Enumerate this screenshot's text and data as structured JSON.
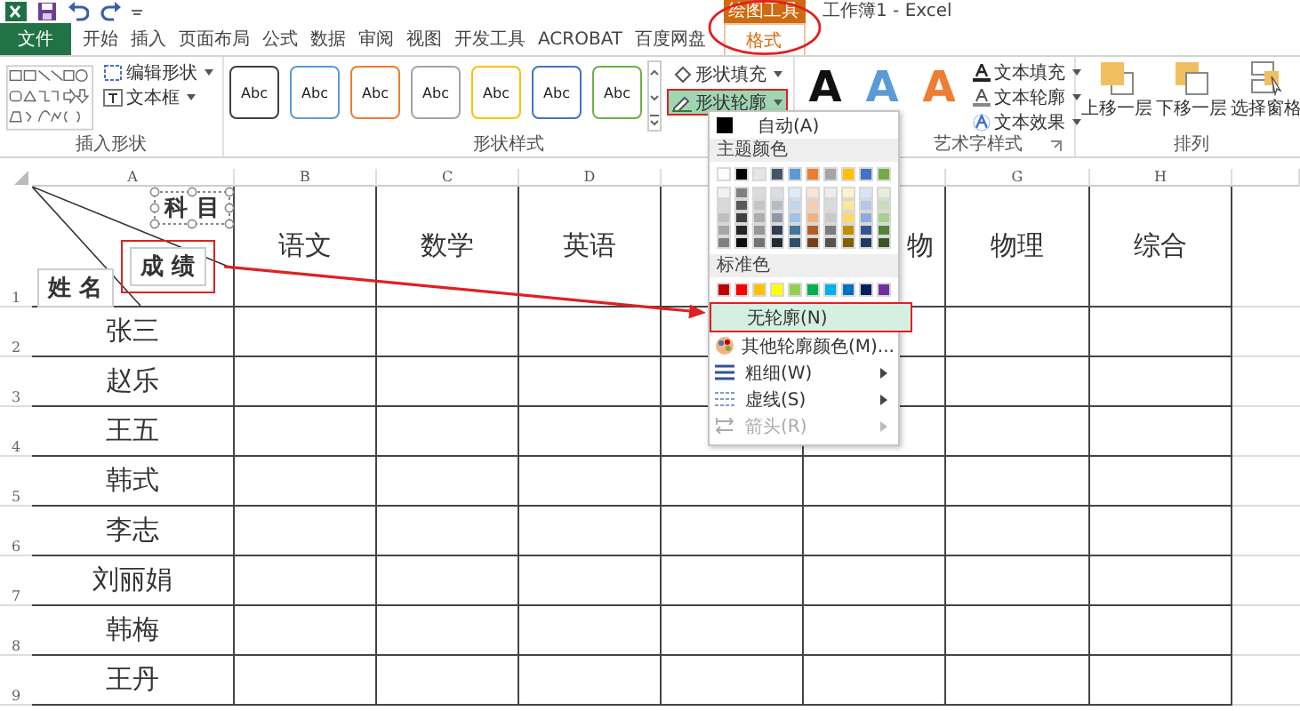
{
  "title_bar": {
    "title": "工作簿1 - Excel",
    "context_label": "绘图工具"
  },
  "tabs": [
    {
      "label": "文件",
      "kind": "file",
      "selected": false
    },
    {
      "label": "开始",
      "kind": "normal",
      "selected": false
    },
    {
      "label": "插入",
      "kind": "normal",
      "selected": false
    },
    {
      "label": "页面布局",
      "kind": "normal",
      "selected": false
    },
    {
      "label": "公式",
      "kind": "normal",
      "selected": false
    },
    {
      "label": "数据",
      "kind": "normal",
      "selected": false
    },
    {
      "label": "审阅",
      "kind": "normal",
      "selected": false
    },
    {
      "label": "视图",
      "kind": "normal",
      "selected": false
    },
    {
      "label": "开发工具",
      "kind": "normal",
      "selected": false
    },
    {
      "label": "ACROBAT",
      "kind": "normal",
      "selected": false
    },
    {
      "label": "百度网盘",
      "kind": "normal",
      "selected": false
    },
    {
      "label": "格式",
      "kind": "contextual",
      "selected": true
    }
  ],
  "ribbon": {
    "insert_shapes": {
      "label": "插入形状",
      "buttons": [
        {
          "label": "编辑形状",
          "kind": "edit"
        },
        {
          "label": "文本框",
          "kind": "textbox"
        }
      ]
    },
    "shape_styles": {
      "label": "形状样式",
      "presets": [
        {
          "text": "Abc",
          "color": "#404040"
        },
        {
          "text": "Abc",
          "color": "#5b9bd5"
        },
        {
          "text": "Abc",
          "color": "#ed7d31"
        },
        {
          "text": "Abc",
          "color": "#a5a5a5"
        },
        {
          "text": "Abc",
          "color": "#ffc000"
        },
        {
          "text": "Abc",
          "color": "#4472c4"
        },
        {
          "text": "Abc",
          "color": "#70ad47"
        }
      ],
      "buttons": [
        {
          "label": "形状填充",
          "kind": "fill",
          "selected": false
        },
        {
          "label": "形状轮廓",
          "kind": "outline",
          "selected": true
        }
      ]
    },
    "wordart": {
      "label": "艺术字样式",
      "letters": [
        {
          "text": "A",
          "kind": "solid",
          "color": "#111111"
        },
        {
          "text": "A",
          "kind": "solid",
          "color": "#5b9bd5"
        },
        {
          "text": "A",
          "kind": "outline",
          "color": "#ed7d31"
        }
      ],
      "buttons": [
        {
          "label": "文本填充",
          "kind": "fill"
        },
        {
          "label": "文本轮廓",
          "kind": "outline"
        },
        {
          "label": "文本效果",
          "kind": "effect"
        }
      ]
    },
    "arrange": {
      "label": "排列",
      "buttons": [
        {
          "label": "上移一层",
          "kind": "forward"
        },
        {
          "label": "下移一层",
          "kind": "backward"
        },
        {
          "label": "选择窗格",
          "kind": "pane"
        }
      ]
    }
  },
  "sheet": {
    "columns_left": [
      "A",
      "B",
      "C",
      "D"
    ],
    "columns_right": [
      "G",
      "H"
    ],
    "subjects_left": [
      "语文",
      "数学",
      "英语"
    ],
    "subject_partial": "物",
    "subjects_right": [
      "物理",
      "综合"
    ],
    "row_numbers": [
      "1",
      "2",
      "3",
      "4",
      "5",
      "6",
      "7",
      "8",
      "9"
    ],
    "names": [
      "张三",
      "赵乐",
      "王五",
      "韩式",
      "李志",
      "刘丽娟",
      "韩梅",
      "王丹"
    ],
    "textboxes": [
      {
        "text": "科 目",
        "kind": "subject",
        "selected": true
      },
      {
        "text": "成 绩",
        "kind": "score",
        "selected": false
      },
      {
        "text": "姓 名",
        "kind": "name",
        "selected": false
      }
    ]
  },
  "menu": {
    "auto_label": "自动(A)",
    "theme_label": "主题颜色",
    "theme_colors": [
      {
        "color": "#ffffff"
      },
      {
        "color": "#000000"
      },
      {
        "color": "#e7e6e6"
      },
      {
        "color": "#44546a"
      },
      {
        "color": "#5b9bd5"
      },
      {
        "color": "#ed7d31"
      },
      {
        "color": "#a5a5a5"
      },
      {
        "color": "#ffc000"
      },
      {
        "color": "#4472c4"
      },
      {
        "color": "#70ad47"
      }
    ],
    "standard_label": "标准色",
    "standard_colors": [
      {
        "color": "#c00000"
      },
      {
        "color": "#ff0000"
      },
      {
        "color": "#ffc000"
      },
      {
        "color": "#ffff00"
      },
      {
        "color": "#92d050"
      },
      {
        "color": "#00b050"
      },
      {
        "color": "#00b0f0"
      },
      {
        "color": "#0070c0"
      },
      {
        "color": "#002060"
      },
      {
        "color": "#7030a0"
      }
    ],
    "items": [
      {
        "label": "无轮廓(N)",
        "kind": "none",
        "selected": true,
        "submenu": false,
        "disabled": false
      },
      {
        "label": "其他轮廓颜色(M)...",
        "kind": "colors",
        "selected": false,
        "submenu": false,
        "disabled": false
      },
      {
        "label": "粗细(W)",
        "kind": "weight",
        "selected": false,
        "submenu": true,
        "disabled": false
      },
      {
        "label": "虚线(S)",
        "kind": "dash",
        "selected": false,
        "submenu": true,
        "disabled": false
      },
      {
        "label": "箭头(R)",
        "kind": "arrow",
        "selected": false,
        "submenu": true,
        "disabled": true
      }
    ]
  }
}
